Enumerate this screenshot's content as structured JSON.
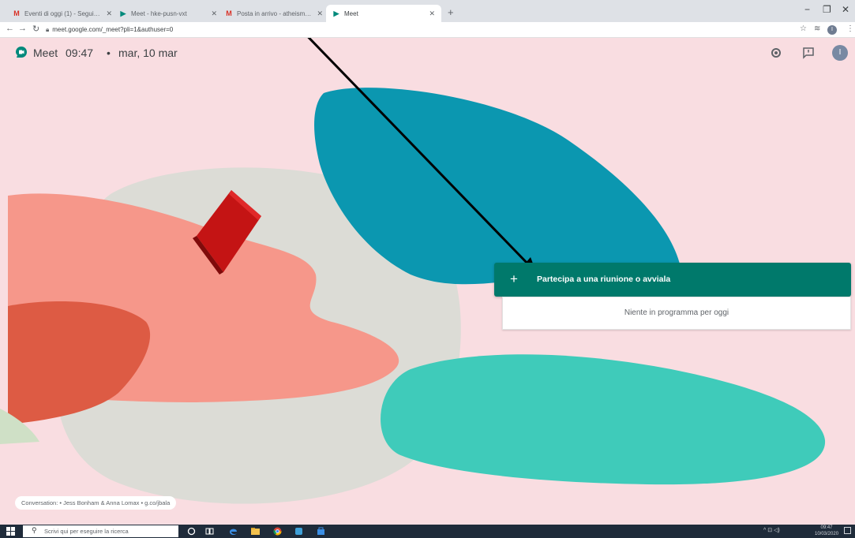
{
  "browser": {
    "tabs": [
      {
        "title": "Eventi di oggi (1) - Segui il MOOC ...",
        "favicon": "gmail-icon",
        "active": false
      },
      {
        "title": "Meet - hke-pusn-vxt",
        "favicon": "meet-icon",
        "active": false
      },
      {
        "title": "Posta in arrivo - atheism@google...",
        "favicon": "gmail-icon",
        "active": false
      },
      {
        "title": "Meet",
        "favicon": "meet-icon",
        "active": true
      }
    ],
    "new_tab_glyph": "+",
    "url": "meet.google.com/_meet?pli=1&authuser=0"
  },
  "meet": {
    "app_name": "Meet",
    "time": "09:47",
    "separator": "•",
    "date": "mar, 10 mar",
    "join_button": {
      "icon": "plus-icon",
      "label": "Partecipa a una riunione o avviala"
    },
    "schedule_message": "Niente in programma per oggi",
    "credit": "Conversation: • Jess Bonham & Anna Lomax • g.co/jbala",
    "avatar_initial": "I",
    "colors": {
      "background": "#f9dde1",
      "accent": "#00796b"
    }
  },
  "taskbar": {
    "search_placeholder": "Scrivi qui per eseguire la ricerca",
    "tray": "^  ⊡  ◁)",
    "time": "09:47",
    "date": "10/03/2020"
  }
}
